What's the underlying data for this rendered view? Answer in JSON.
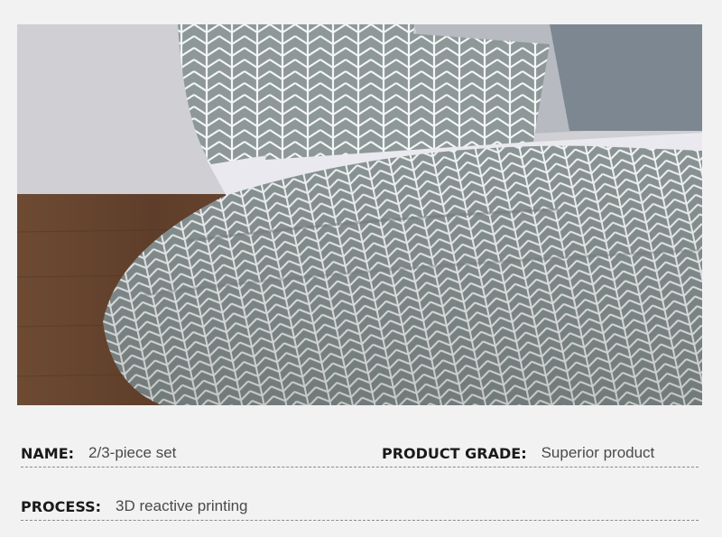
{
  "photo": {
    "alt": "Gray herringbone duvet set on a bed with pillows",
    "colors": {
      "wall": "#cfcfd4",
      "floor": "#6b4630",
      "fabric": "#8e9898",
      "pattern_line": "#f4f6f6",
      "cushion_light": "#b7bbc1",
      "cushion_dark": "#7d8791",
      "sheet": "#e9e9ef"
    }
  },
  "specs": {
    "name": {
      "label": "NAME:",
      "value": "2/3-piece set"
    },
    "grade": {
      "label": "PRODUCT GRADE:",
      "value": "Superior product"
    },
    "process": {
      "label": "PROCESS:",
      "value": "3D reactive printing"
    }
  }
}
